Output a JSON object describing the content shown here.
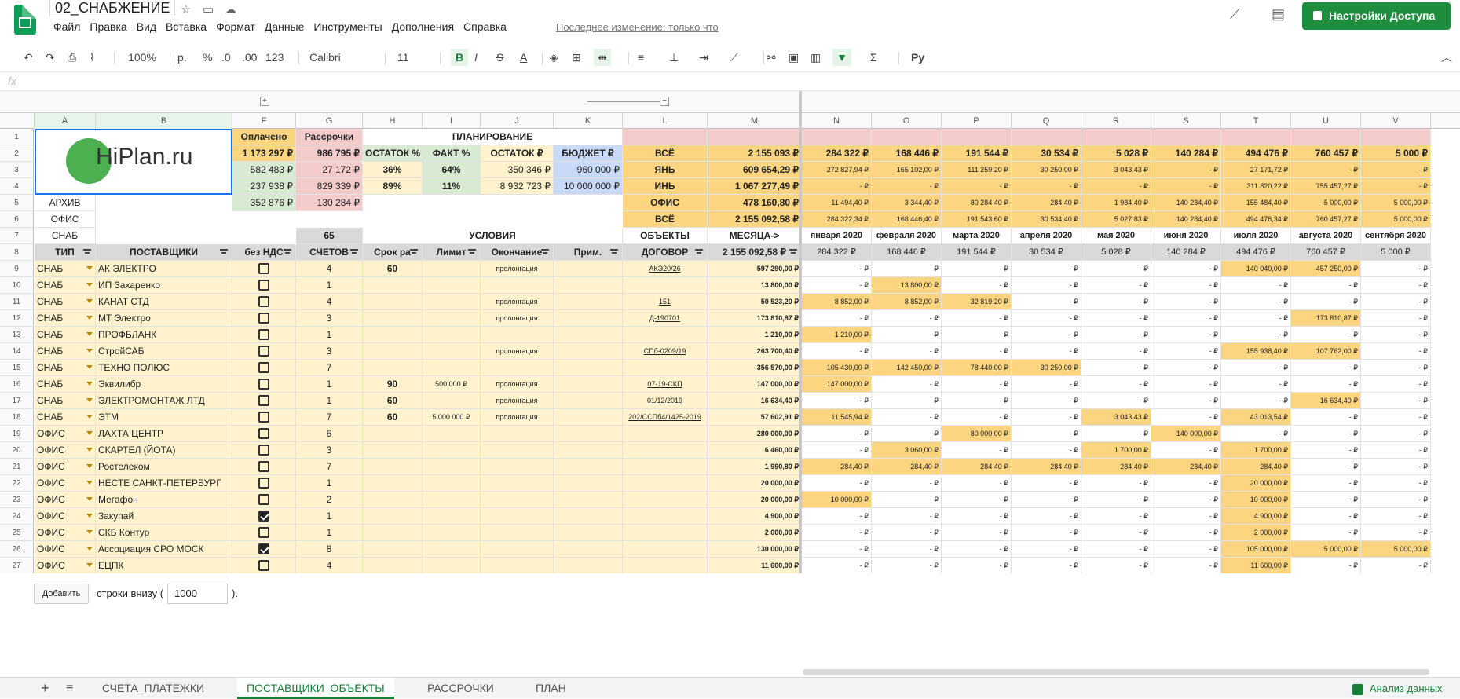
{
  "doc": {
    "title": "02_СНАБЖЕНИЕ",
    "last_edit": "Последнее изменение: только что",
    "share": "Настройки Доступа"
  },
  "menu": [
    "Файл",
    "Правка",
    "Вид",
    "Вставка",
    "Формат",
    "Данные",
    "Инструменты",
    "Дополнения",
    "Справка"
  ],
  "toolbar": {
    "zoom": "100%",
    "currency": "р.",
    "percent": "%",
    "dec_less": ".0",
    "dec_more": ".00",
    "format_more": "123",
    "font": "Calibri",
    "size": "11",
    "bold": "B",
    "italic": "I",
    "strike": "S",
    "text_color": "A",
    "script": "Py"
  },
  "fx": "fx",
  "columns": [
    "A",
    "B",
    "F",
    "G",
    "H",
    "I",
    "J",
    "K",
    "L",
    "M",
    "N",
    "O",
    "P",
    "Q",
    "R",
    "S",
    "T",
    "U",
    "V"
  ],
  "logo_text": "HiPlan.ru",
  "top": {
    "paid_label": "Оплачено",
    "installments_label": "Рассрочки",
    "planning_label": "ПЛАНИРОВАНИЕ",
    "paid": [
      "1 173 297 ₽",
      "582 483 ₽",
      "237 938 ₽",
      "352 876 ₽"
    ],
    "installments": [
      "986 795 ₽",
      "27 172 ₽",
      "829 339 ₽",
      "130 284 ₽"
    ],
    "plan_headers": [
      "ОСТАТОК %",
      "ФАКТ %",
      "ОСТАТОК ₽",
      "БЮДЖЕТ ₽"
    ],
    "plan_row3": [
      "36%",
      "64%",
      "350 346 ₽",
      "960 000 ₽"
    ],
    "plan_row4": [
      "89%",
      "11%",
      "8 932 723 ₽",
      "10 000 000 ₽"
    ],
    "labels_a": [
      "АРХИВ",
      "ОФИС",
      "СНАБ"
    ],
    "l_labels": [
      "ВСЁ",
      "ЯНЬ",
      "ИНЬ",
      "ОФИС",
      "ВСЁ"
    ],
    "m_values": [
      "2 155 093 ₽",
      "609 654,29 ₽",
      "1 067 277,49 ₽",
      "478 160,80 ₽",
      "2 155 092,58 ₽"
    ],
    "count": "65",
    "conditions": "УСЛОВИЯ",
    "objects": "ОБЪЕКТЫ",
    "months_arrow": "МЕСЯЦА->"
  },
  "months": {
    "row2": [
      "284 322 ₽",
      "168 446 ₽",
      "191 544 ₽",
      "30 534 ₽",
      "5 028 ₽",
      "140 284 ₽",
      "494 476 ₽",
      "760 457 ₽",
      "5 000 ₽"
    ],
    "row3": [
      "272 827,94 ₽",
      "165 102,00 ₽",
      "111 259,20 ₽",
      "30 250,00 ₽",
      "3 043,43 ₽",
      "-   ₽",
      "27 171,72 ₽",
      "-   ₽",
      "-   ₽"
    ],
    "row4": [
      "-   ₽",
      "-   ₽",
      "-   ₽",
      "-   ₽",
      "-   ₽",
      "-   ₽",
      "311 820,22 ₽",
      "755 457,27 ₽",
      "-   ₽"
    ],
    "row5": [
      "11 494,40 ₽",
      "3 344,40 ₽",
      "80 284,40 ₽",
      "284,40 ₽",
      "1 984,40 ₽",
      "140 284,40 ₽",
      "155 484,40 ₽",
      "5 000,00 ₽",
      "5 000,00 ₽"
    ],
    "row6": [
      "284 322,34 ₽",
      "168 446,40 ₽",
      "191 543,60 ₽",
      "30 534,40 ₽",
      "5 027,83 ₽",
      "140 284,40 ₽",
      "494 476,34 ₽",
      "760 457,27 ₽",
      "5 000,00 ₽"
    ],
    "names": [
      "января 2020",
      "февраля 2020",
      "марта 2020",
      "апреля 2020",
      "мая 2020",
      "июня 2020",
      "июля 2020",
      "августа 2020",
      "сентября 2020"
    ],
    "totals": [
      "284 322 ₽",
      "168 446 ₽",
      "191 544 ₽",
      "30 534 ₽",
      "5 028 ₽",
      "140 284 ₽",
      "494 476 ₽",
      "760 457 ₽",
      "5 000 ₽"
    ]
  },
  "headers8": [
    "ТИП",
    "ПОСТАВЩИКИ",
    "без НДС",
    "СЧЕТОВ",
    "Срок ра",
    "Лимит",
    "Окончание",
    "Прим.",
    "ДОГОВОР",
    "2 155 092,58 ₽"
  ],
  "rows": [
    {
      "n": "9",
      "type": "СНАБ",
      "name": "АК ЭЛЕКТРО",
      "chk": false,
      "cnt": "4",
      "term": "60",
      "limit": "",
      "end": "пролонгация",
      "contract": "АКЭ20/26",
      "total": "597 290,00 ₽",
      "m": [
        "-   ₽",
        "-   ₽",
        "-   ₽",
        "-   ₽",
        "-   ₽",
        "-   ₽",
        "140 040,00 ₽",
        "457 250,00 ₽",
        "-   ₽"
      ]
    },
    {
      "n": "10",
      "type": "СНАБ",
      "name": "ИП Захаренко",
      "chk": false,
      "cnt": "1",
      "term": "",
      "limit": "",
      "end": "",
      "contract": "",
      "total": "13 800,00 ₽",
      "m": [
        "-   ₽",
        "13 800,00 ₽",
        "-   ₽",
        "-   ₽",
        "-   ₽",
        "-   ₽",
        "-   ₽",
        "-   ₽",
        "-   ₽"
      ]
    },
    {
      "n": "11",
      "type": "СНАБ",
      "name": "КАНАТ СТД",
      "chk": false,
      "cnt": "4",
      "term": "",
      "limit": "",
      "end": "пролонгация",
      "contract": "151",
      "total": "50 523,20 ₽",
      "m": [
        "8 852,00 ₽",
        "8 852,00 ₽",
        "32 819,20 ₽",
        "-   ₽",
        "-   ₽",
        "-   ₽",
        "-   ₽",
        "-   ₽",
        "-   ₽"
      ]
    },
    {
      "n": "12",
      "type": "СНАБ",
      "name": "МТ Электро",
      "chk": false,
      "cnt": "3",
      "term": "",
      "limit": "",
      "end": "пролонгация",
      "contract": "Д-190701",
      "total": "173 810,87 ₽",
      "m": [
        "-   ₽",
        "-   ₽",
        "-   ₽",
        "-   ₽",
        "-   ₽",
        "-   ₽",
        "-   ₽",
        "173 810,87 ₽",
        "-   ₽"
      ]
    },
    {
      "n": "13",
      "type": "СНАБ",
      "name": "ПРОФБЛАНК",
      "chk": false,
      "cnt": "1",
      "term": "",
      "limit": "",
      "end": "",
      "contract": "",
      "total": "1 210,00 ₽",
      "m": [
        "1 210,00 ₽",
        "-   ₽",
        "-   ₽",
        "-   ₽",
        "-   ₽",
        "-   ₽",
        "-   ₽",
        "-   ₽",
        "-   ₽"
      ]
    },
    {
      "n": "14",
      "type": "СНАБ",
      "name": "СтройСАБ",
      "chk": false,
      "cnt": "3",
      "term": "",
      "limit": "",
      "end": "пролонгация",
      "contract": "СПб-0209/19",
      "total": "263 700,40 ₽",
      "m": [
        "-   ₽",
        "-   ₽",
        "-   ₽",
        "-   ₽",
        "-   ₽",
        "-   ₽",
        "155 938,40 ₽",
        "107 762,00 ₽",
        "-   ₽"
      ]
    },
    {
      "n": "15",
      "type": "СНАБ",
      "name": "ТЕХНО ПОЛЮС",
      "chk": false,
      "cnt": "7",
      "term": "",
      "limit": "",
      "end": "",
      "contract": "",
      "total": "356 570,00 ₽",
      "m": [
        "105 430,00 ₽",
        "142 450,00 ₽",
        "78 440,00 ₽",
        "30 250,00 ₽",
        "-   ₽",
        "-   ₽",
        "-   ₽",
        "-   ₽",
        "-   ₽"
      ]
    },
    {
      "n": "16",
      "type": "СНАБ",
      "name": "Эквилибр",
      "chk": false,
      "cnt": "1",
      "term": "90",
      "limit": "500 000 ₽",
      "end": "пролонгация",
      "contract": "07-19-СКП",
      "total": "147 000,00 ₽",
      "m": [
        "147 000,00 ₽",
        "-   ₽",
        "-   ₽",
        "-   ₽",
        "-   ₽",
        "-   ₽",
        "-   ₽",
        "-   ₽",
        "-   ₽"
      ]
    },
    {
      "n": "17",
      "type": "СНАБ",
      "name": "ЭЛЕКТРОМОНТАЖ ЛТД",
      "chk": false,
      "cnt": "1",
      "term": "60",
      "limit": "",
      "end": "пролонгация",
      "contract": "01/12/2019",
      "total": "16 634,40 ₽",
      "m": [
        "-   ₽",
        "-   ₽",
        "-   ₽",
        "-   ₽",
        "-   ₽",
        "-   ₽",
        "-   ₽",
        "16 634,40 ₽",
        "-   ₽"
      ]
    },
    {
      "n": "18",
      "type": "СНАБ",
      "name": "ЭТМ",
      "chk": false,
      "cnt": "7",
      "term": "60",
      "limit": "5 000 000 ₽",
      "end": "пролонгация",
      "contract": "202/ССПб4/1425-2019",
      "total": "57 602,91 ₽",
      "m": [
        "11 545,94 ₽",
        "-   ₽",
        "-   ₽",
        "-   ₽",
        "3 043,43 ₽",
        "-   ₽",
        "43 013,54 ₽",
        "-   ₽",
        "-   ₽"
      ]
    },
    {
      "n": "19",
      "type": "ОФИС",
      "name": "ЛАХТА ЦЕНТР",
      "chk": false,
      "cnt": "6",
      "term": "",
      "limit": "",
      "end": "",
      "contract": "",
      "total": "280 000,00 ₽",
      "m": [
        "-   ₽",
        "-   ₽",
        "80 000,00 ₽",
        "-   ₽",
        "-   ₽",
        "140 000,00 ₽",
        "-   ₽",
        "-   ₽",
        "-   ₽"
      ]
    },
    {
      "n": "20",
      "type": "ОФИС",
      "name": "СКАРТЕЛ (ЙОТА)",
      "chk": false,
      "cnt": "3",
      "term": "",
      "limit": "",
      "end": "",
      "contract": "",
      "total": "6 460,00 ₽",
      "m": [
        "-   ₽",
        "3 060,00 ₽",
        "-   ₽",
        "-   ₽",
        "1 700,00 ₽",
        "-   ₽",
        "1 700,00 ₽",
        "-   ₽",
        "-   ₽"
      ]
    },
    {
      "n": "21",
      "type": "ОФИС",
      "name": "Ростелеком",
      "chk": false,
      "cnt": "7",
      "term": "",
      "limit": "",
      "end": "",
      "contract": "",
      "total": "1 990,80 ₽",
      "m": [
        "284,40 ₽",
        "284,40 ₽",
        "284,40 ₽",
        "284,40 ₽",
        "284,40 ₽",
        "284,40 ₽",
        "284,40 ₽",
        "-   ₽",
        "-   ₽"
      ]
    },
    {
      "n": "22",
      "type": "ОФИС",
      "name": "НЕСТЕ САНКТ-ПЕТЕРБУРГ",
      "chk": false,
      "cnt": "1",
      "term": "",
      "limit": "",
      "end": "",
      "contract": "",
      "total": "20 000,00 ₽",
      "m": [
        "-   ₽",
        "-   ₽",
        "-   ₽",
        "-   ₽",
        "-   ₽",
        "-   ₽",
        "20 000,00 ₽",
        "-   ₽",
        "-   ₽"
      ]
    },
    {
      "n": "23",
      "type": "ОФИС",
      "name": "Мегафон",
      "chk": false,
      "cnt": "2",
      "term": "",
      "limit": "",
      "end": "",
      "contract": "",
      "total": "20 000,00 ₽",
      "m": [
        "10 000,00 ₽",
        "-   ₽",
        "-   ₽",
        "-   ₽",
        "-   ₽",
        "-   ₽",
        "10 000,00 ₽",
        "-   ₽",
        "-   ₽"
      ]
    },
    {
      "n": "24",
      "type": "ОФИС",
      "name": "Закупай",
      "chk": true,
      "cnt": "1",
      "term": "",
      "limit": "",
      "end": "",
      "contract": "",
      "total": "4 900,00 ₽",
      "m": [
        "-   ₽",
        "-   ₽",
        "-   ₽",
        "-   ₽",
        "-   ₽",
        "-   ₽",
        "4 900,00 ₽",
        "-   ₽",
        "-   ₽"
      ]
    },
    {
      "n": "25",
      "type": "ОФИС",
      "name": "СКБ Контур",
      "chk": false,
      "cnt": "1",
      "term": "",
      "limit": "",
      "end": "",
      "contract": "",
      "total": "2 000,00 ₽",
      "m": [
        "-   ₽",
        "-   ₽",
        "-   ₽",
        "-   ₽",
        "-   ₽",
        "-   ₽",
        "2 000,00 ₽",
        "-   ₽",
        "-   ₽"
      ]
    },
    {
      "n": "26",
      "type": "ОФИС",
      "name": "Ассоциация СРО МОСК",
      "chk": true,
      "cnt": "8",
      "term": "",
      "limit": "",
      "end": "",
      "contract": "",
      "total": "130 000,00 ₽",
      "m": [
        "-   ₽",
        "-   ₽",
        "-   ₽",
        "-   ₽",
        "-   ₽",
        "-   ₽",
        "105 000,00 ₽",
        "5 000,00 ₽",
        "5 000,00 ₽"
      ]
    },
    {
      "n": "27",
      "type": "ОФИС",
      "name": "ЕЦПК",
      "chk": false,
      "cnt": "4",
      "term": "",
      "limit": "",
      "end": "",
      "contract": "",
      "total": "11 600,00 ₽",
      "m": [
        "-   ₽",
        "-   ₽",
        "-   ₽",
        "-   ₽",
        "-   ₽",
        "-   ₽",
        "11 600,00 ₽",
        "-   ₽",
        "-   ₽"
      ]
    }
  ],
  "bottom": {
    "add": "Добавить",
    "text": "строки внизу (",
    "value": "1000",
    "tail": ")."
  },
  "tabs": [
    "СЧЕТА_ПЛАТЕЖКИ",
    "ПОСТАВЩИКИ_ОБЪЕКТЫ",
    "РАССРОЧКИ",
    "ПЛАН"
  ],
  "explore": "Анализ данных"
}
